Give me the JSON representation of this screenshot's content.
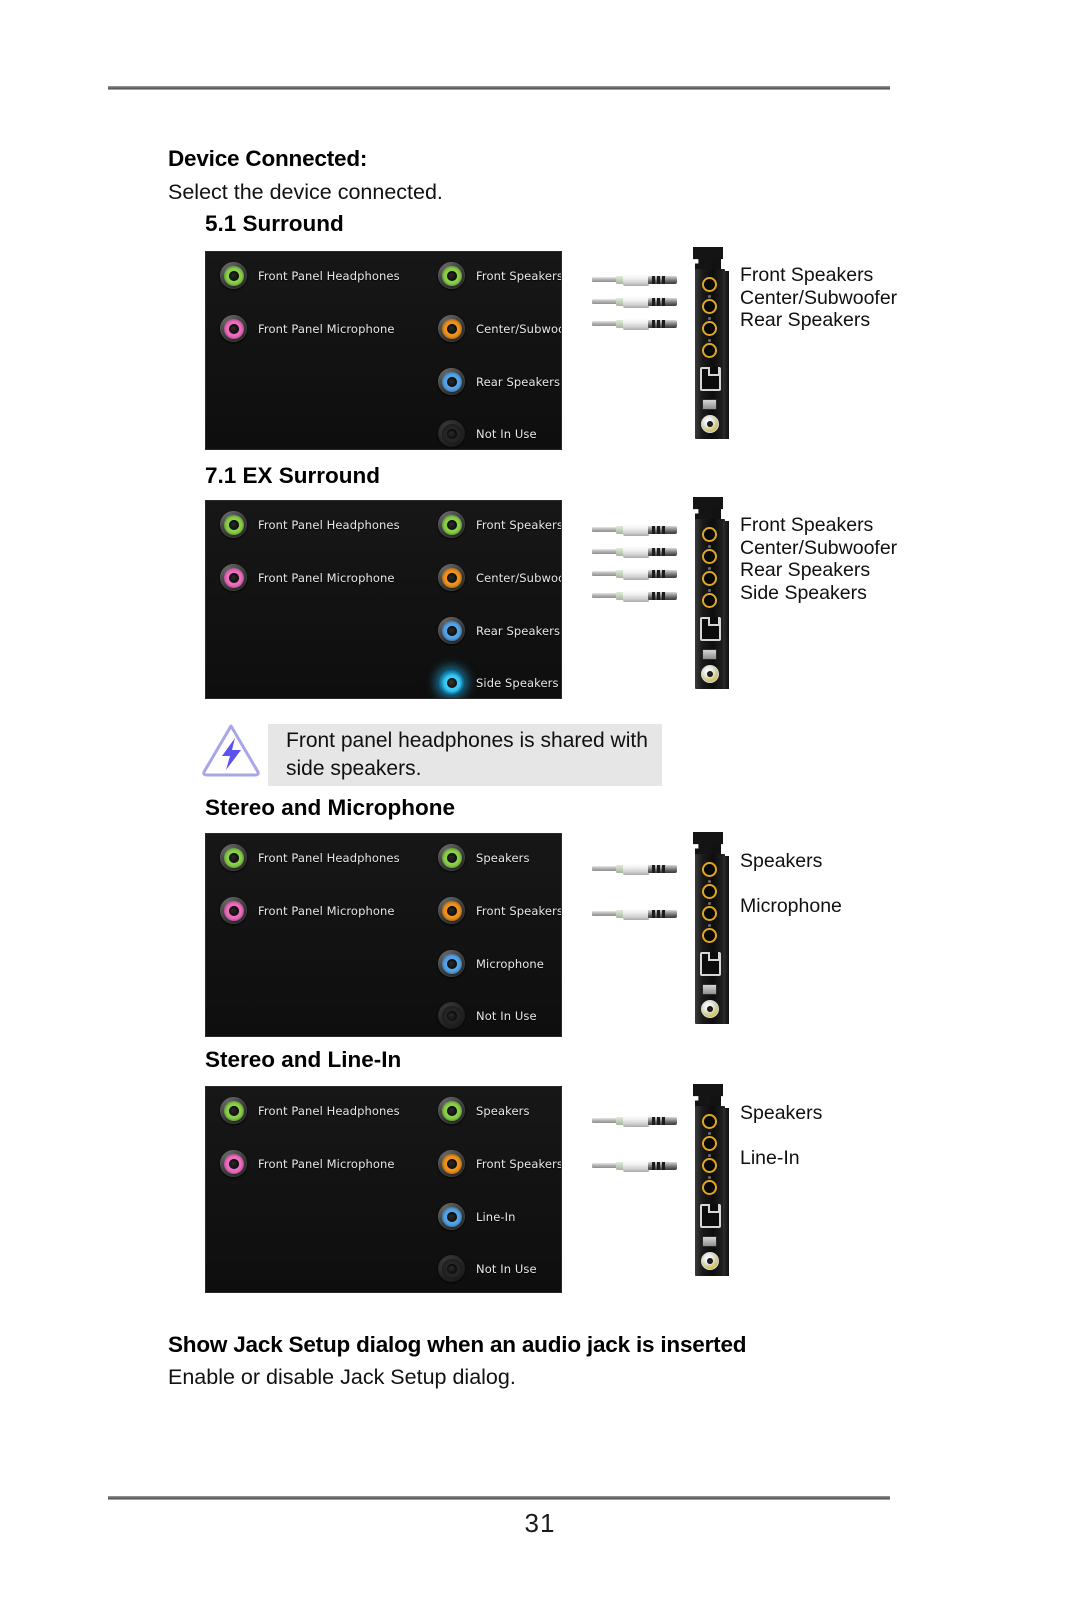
{
  "page": {
    "number": "31"
  },
  "section": {
    "title": "Device Connected:",
    "description": "Select the device connected."
  },
  "note": {
    "text": "Front panel headphones is shared with side speakers.",
    "icon": "warning-triangle-icon"
  },
  "footer_section": {
    "title": "Show Jack Setup dialog when an audio jack is inserted",
    "description": "Enable or disable Jack Setup dialog."
  },
  "colors": {
    "green": "#8bd14a",
    "pink": "#f06ec0",
    "orange": "#f0941f",
    "blue": "#56a5e8",
    "cyan_glow": "#39cdf7",
    "off": "#262626",
    "jack_gold": "#e0a81f",
    "note_bg": "#e6e6e6",
    "panel_bg": "#141414"
  },
  "configs": [
    {
      "id": "surround-51",
      "heading": "5.1 Surround",
      "left_column": [
        {
          "label": "Front Panel Headphones",
          "color": "#8bd14a",
          "state": "on"
        },
        {
          "label": "Front Panel Microphone",
          "color": "#f06ec0",
          "state": "on"
        }
      ],
      "right_column": [
        {
          "label": "Front Speakers",
          "color": "#8bd14a",
          "state": "on"
        },
        {
          "label": "Center/Subwoofer",
          "color": "#f0941f",
          "state": "on"
        },
        {
          "label": "Rear Speakers",
          "color": "#56a5e8",
          "state": "on"
        },
        {
          "label": "Not In Use",
          "color": "#262626",
          "state": "off"
        }
      ],
      "bracket": {
        "plug_count": 3,
        "labels": [
          "Front Speakers",
          "Center/Subwoofer",
          "Rear Speakers"
        ]
      }
    },
    {
      "id": "surround-71ex",
      "heading": "7.1 EX Surround",
      "left_column": [
        {
          "label": "Front Panel Headphones",
          "color": "#8bd14a",
          "state": "on"
        },
        {
          "label": "Front Panel Microphone",
          "color": "#f06ec0",
          "state": "on"
        }
      ],
      "right_column": [
        {
          "label": "Front Speakers",
          "color": "#8bd14a",
          "state": "on"
        },
        {
          "label": "Center/Subwoofer",
          "color": "#f0941f",
          "state": "on"
        },
        {
          "label": "Rear Speakers",
          "color": "#56a5e8",
          "state": "on"
        },
        {
          "label": "Side Speakers",
          "color": "#39cdf7",
          "state": "glow"
        }
      ],
      "bracket": {
        "plug_count": 4,
        "labels": [
          "Front Speakers",
          "Center/Subwoofer",
          "Rear Speakers",
          "Side Speakers"
        ]
      }
    },
    {
      "id": "stereo-microphone",
      "heading": "Stereo and Microphone",
      "left_column": [
        {
          "label": "Front Panel Headphones",
          "color": "#8bd14a",
          "state": "on"
        },
        {
          "label": "Front Panel Microphone",
          "color": "#f06ec0",
          "state": "on"
        }
      ],
      "right_column": [
        {
          "label": "Speakers",
          "color": "#8bd14a",
          "state": "on"
        },
        {
          "label": "Front Speakers",
          "color": "#f0941f",
          "state": "on"
        },
        {
          "label": "Microphone",
          "color": "#56a5e8",
          "state": "on"
        },
        {
          "label": "Not In Use",
          "color": "#262626",
          "state": "off"
        }
      ],
      "bracket": {
        "plug_count": 2,
        "labels": [
          "Speakers",
          "Microphone"
        ]
      }
    },
    {
      "id": "stereo-linein",
      "heading": "Stereo and Line-In",
      "left_column": [
        {
          "label": "Front Panel Headphones",
          "color": "#8bd14a",
          "state": "on"
        },
        {
          "label": "Front Panel Microphone",
          "color": "#f06ec0",
          "state": "on"
        }
      ],
      "right_column": [
        {
          "label": "Speakers",
          "color": "#8bd14a",
          "state": "on"
        },
        {
          "label": "Front Speakers",
          "color": "#f0941f",
          "state": "on"
        },
        {
          "label": "Line-In",
          "color": "#56a5e8",
          "state": "on"
        },
        {
          "label": "Not In Use",
          "color": "#262626",
          "state": "off"
        }
      ],
      "bracket": {
        "plug_count": 2,
        "labels": [
          "Speakers",
          "Line-In"
        ]
      }
    }
  ]
}
